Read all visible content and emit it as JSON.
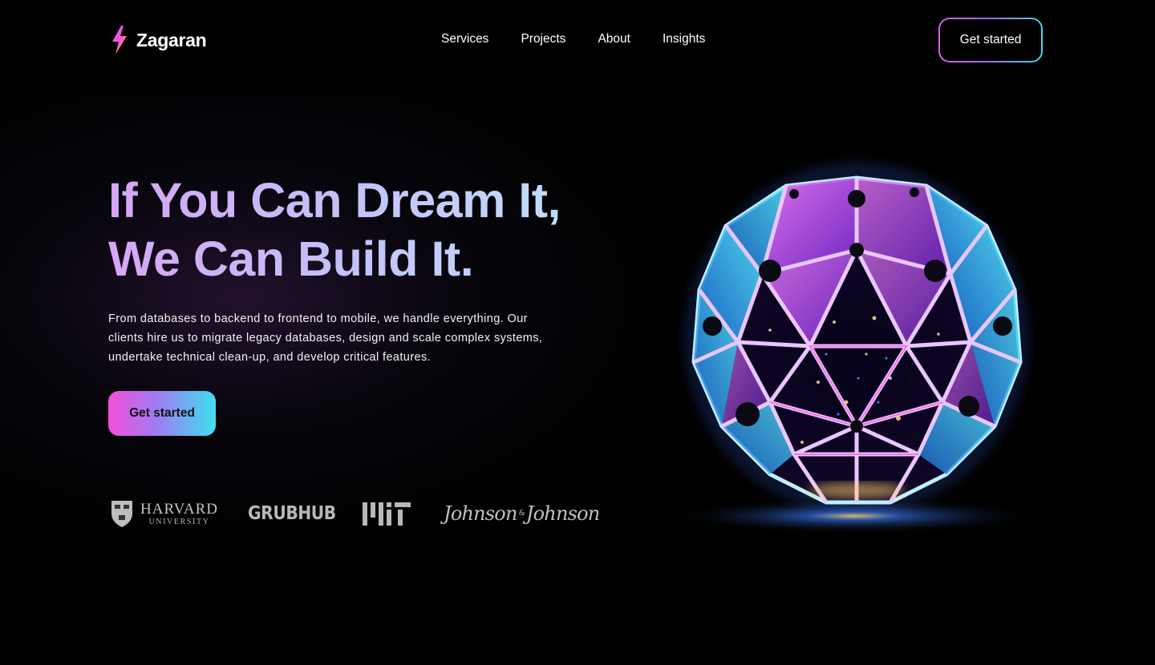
{
  "brand": {
    "name": "Zagaran",
    "icon": "lightning-bolt-icon"
  },
  "nav": {
    "links": [
      "Services",
      "Projects",
      "About",
      "Insights"
    ],
    "cta_label": "Get started"
  },
  "hero": {
    "title_line1": "If You Can Dream It,",
    "title_line2": "We Can Build It.",
    "description": "From databases to backend to frontend to mobile, we handle everything. Our clients hire us to migrate legacy databases, design and scale complex systems, undertake technical clean-up, and develop critical features.",
    "cta_label": "Get started",
    "image": "geodesic-crystal-sphere-image"
  },
  "clients": {
    "harvard": {
      "name": "HARVARD",
      "sub": "UNIVERSITY"
    },
    "grubhub": "GRUBHUB",
    "mit": "MIT",
    "jnj": {
      "left": "Johnson",
      "amp": "&",
      "right": "Johnson"
    }
  },
  "colors": {
    "background": "#000000",
    "accent_pink": "#f24fd8",
    "accent_purple": "#9f7cf2",
    "accent_cyan": "#3ee0f0"
  }
}
